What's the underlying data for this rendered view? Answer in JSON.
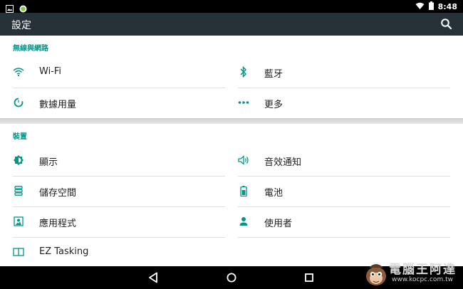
{
  "status_bar": {
    "time": "8:48",
    "icons": [
      "image-icon",
      "message-icon",
      "wifi-icon",
      "battery-icon"
    ]
  },
  "app_bar": {
    "title": "設定",
    "search_icon": "search-icon"
  },
  "colors": {
    "accent": "#009688",
    "app_bar": "#263238",
    "background": "#eeeeee"
  },
  "sections": [
    {
      "header": "無線與網路",
      "items": [
        {
          "label": "Wi-Fi",
          "icon": "wifi-icon"
        },
        {
          "label": "藍牙",
          "icon": "bluetooth-icon"
        },
        {
          "label": "數據用量",
          "icon": "data-usage-icon"
        },
        {
          "label": "更多",
          "icon": "more-icon"
        }
      ]
    },
    {
      "header": "裝置",
      "items": [
        {
          "label": "顯示",
          "icon": "brightness-icon"
        },
        {
          "label": "音效通知",
          "icon": "volume-icon"
        },
        {
          "label": "儲存空間",
          "icon": "storage-icon"
        },
        {
          "label": "電池",
          "icon": "battery-icon"
        },
        {
          "label": "應用程式",
          "icon": "apps-icon"
        },
        {
          "label": "使用者",
          "icon": "person-icon"
        },
        {
          "label": "EZ Tasking",
          "icon": "ez-tasking-icon"
        }
      ]
    }
  ],
  "nav_bar": {
    "buttons": [
      "back-icon",
      "home-icon",
      "recents-icon"
    ]
  },
  "watermark": {
    "text": "電腦王阿達",
    "url": "www.kocpc.com.tw"
  }
}
